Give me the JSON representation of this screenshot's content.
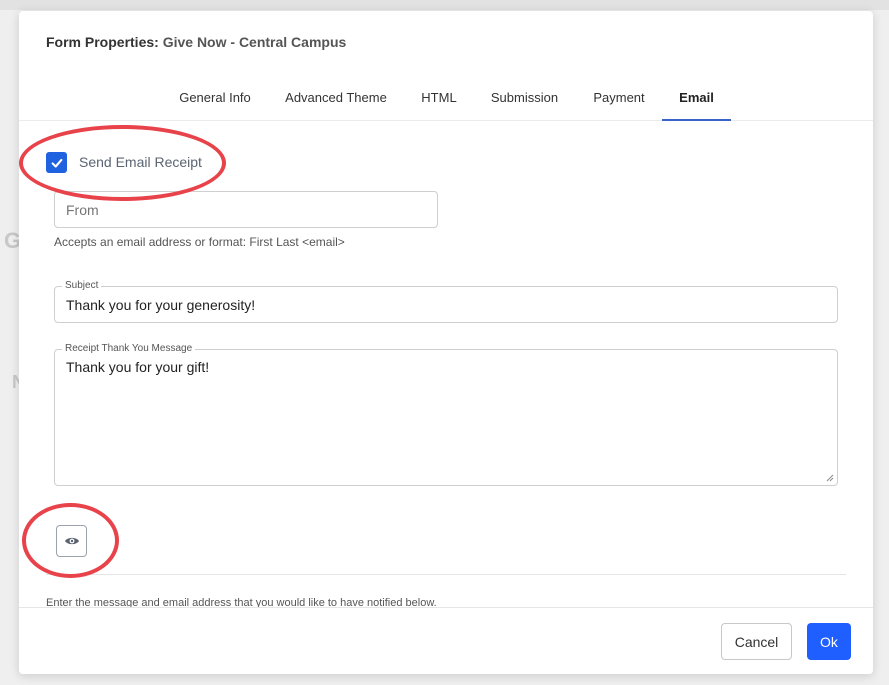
{
  "modal": {
    "title_prefix": "Form Properties:",
    "title_value": "Give Now - Central Campus"
  },
  "tabs": [
    {
      "label": "General Info"
    },
    {
      "label": "Advanced Theme"
    },
    {
      "label": "HTML"
    },
    {
      "label": "Submission"
    },
    {
      "label": "Payment"
    },
    {
      "label": "Email",
      "active": true
    }
  ],
  "email": {
    "send_receipt_label": "Send Email Receipt",
    "send_receipt_checked": true,
    "from_placeholder": "From",
    "from_help": "Accepts an email address or format: First Last <email>",
    "subject_label": "Subject",
    "subject_value": "Thank you for your generosity!",
    "message_label": "Receipt Thank You Message",
    "message_value": "Thank you for your gift!",
    "notify_note": "Enter the message and email address that you would like to have notified below."
  },
  "footer": {
    "cancel_label": "Cancel",
    "ok_label": "Ok"
  },
  "colors": {
    "accent": "#1f5fff",
    "checkbox": "#1f62e0",
    "annotation": "#e8424a"
  },
  "icons": {
    "checkbox": "check-icon",
    "preview": "eye-icon"
  }
}
